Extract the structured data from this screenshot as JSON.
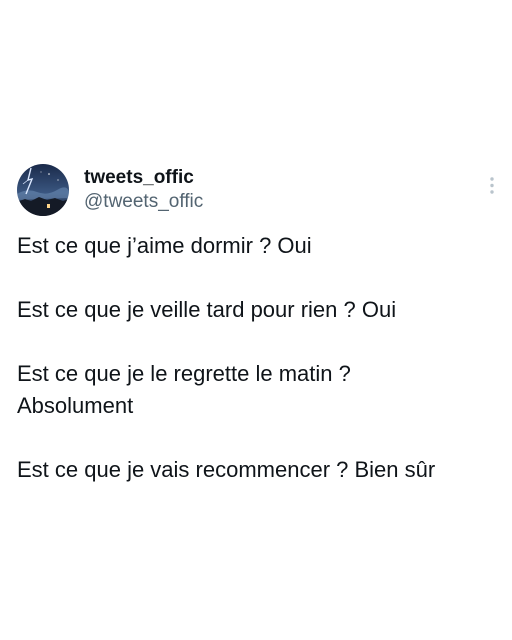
{
  "author": {
    "display_name": "tweets_offic",
    "handle": "@tweets_offic",
    "avatar_icon": "night-sky-lightning-avatar"
  },
  "menu": {
    "icon": "more-vertical-icon"
  },
  "tweet": {
    "lines": [
      "Est ce que j’aime dormir ? Oui",
      "",
      "Est ce que je veille tard pour rien ? Oui",
      "",
      "Est ce que je le regrette le matin ?",
      "Absolument",
      "",
      "Est ce que je vais recommencer ? Bien sûr"
    ]
  },
  "colors": {
    "text_primary": "#0f1419",
    "text_secondary": "#536471",
    "menu_icon": "#b9c4cc",
    "background": "#ffffff"
  }
}
